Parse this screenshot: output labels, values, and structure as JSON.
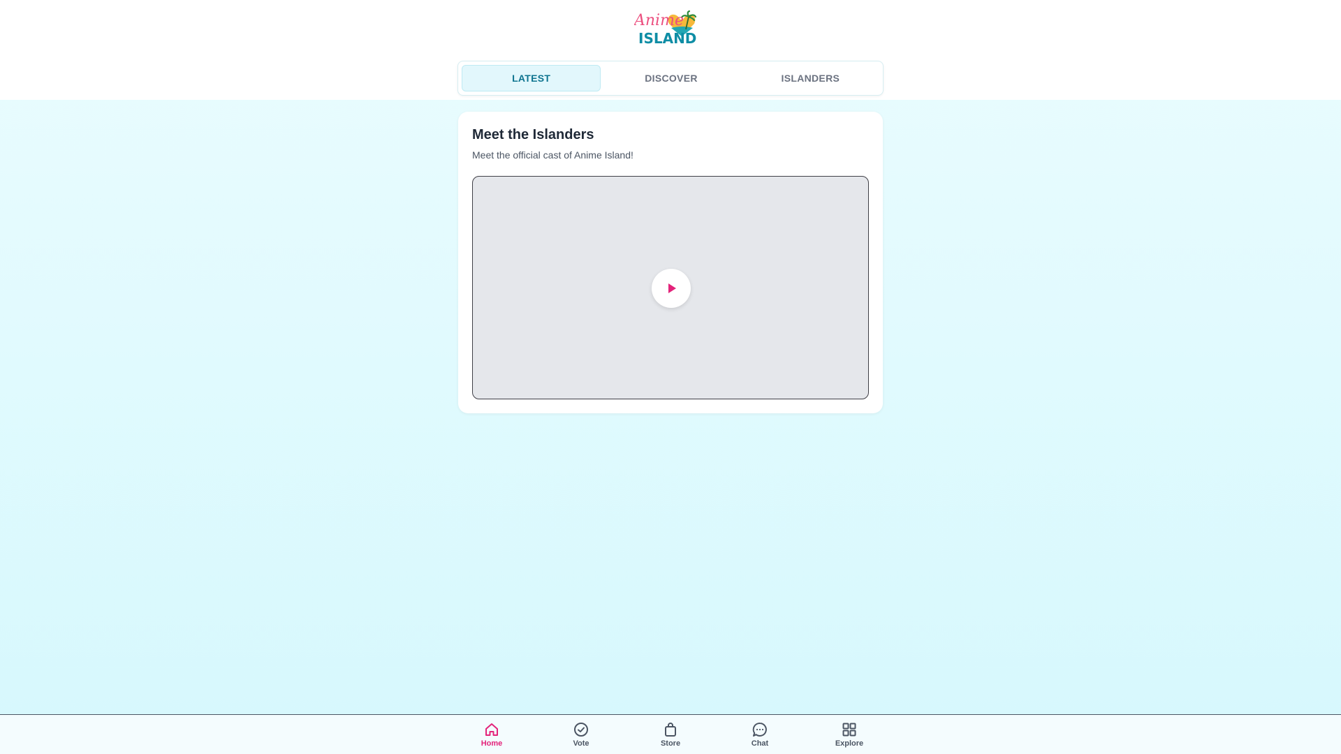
{
  "header": {
    "logo_top": "Anime",
    "logo_bottom": "ISLAND"
  },
  "tabs": [
    {
      "label": "LATEST",
      "active": true
    },
    {
      "label": "DISCOVER",
      "active": false
    },
    {
      "label": "ISLANDERS",
      "active": false
    }
  ],
  "card": {
    "title": "Meet the Islanders",
    "subtitle": "Meet the official cast of Anime Island!",
    "video_icon": "play-icon"
  },
  "bottom_nav": [
    {
      "label": "Home",
      "icon": "home-icon",
      "active": true
    },
    {
      "label": "Vote",
      "icon": "check-circle-icon",
      "active": false
    },
    {
      "label": "Store",
      "icon": "shopping-bag-icon",
      "active": false
    },
    {
      "label": "Chat",
      "icon": "chat-bubble-icon",
      "active": false
    },
    {
      "label": "Explore",
      "icon": "grid-icon",
      "active": false
    }
  ],
  "colors": {
    "accent_pink": "#e3237a",
    "accent_teal": "#0e7490",
    "logo_yellow": "#f6b93b"
  }
}
